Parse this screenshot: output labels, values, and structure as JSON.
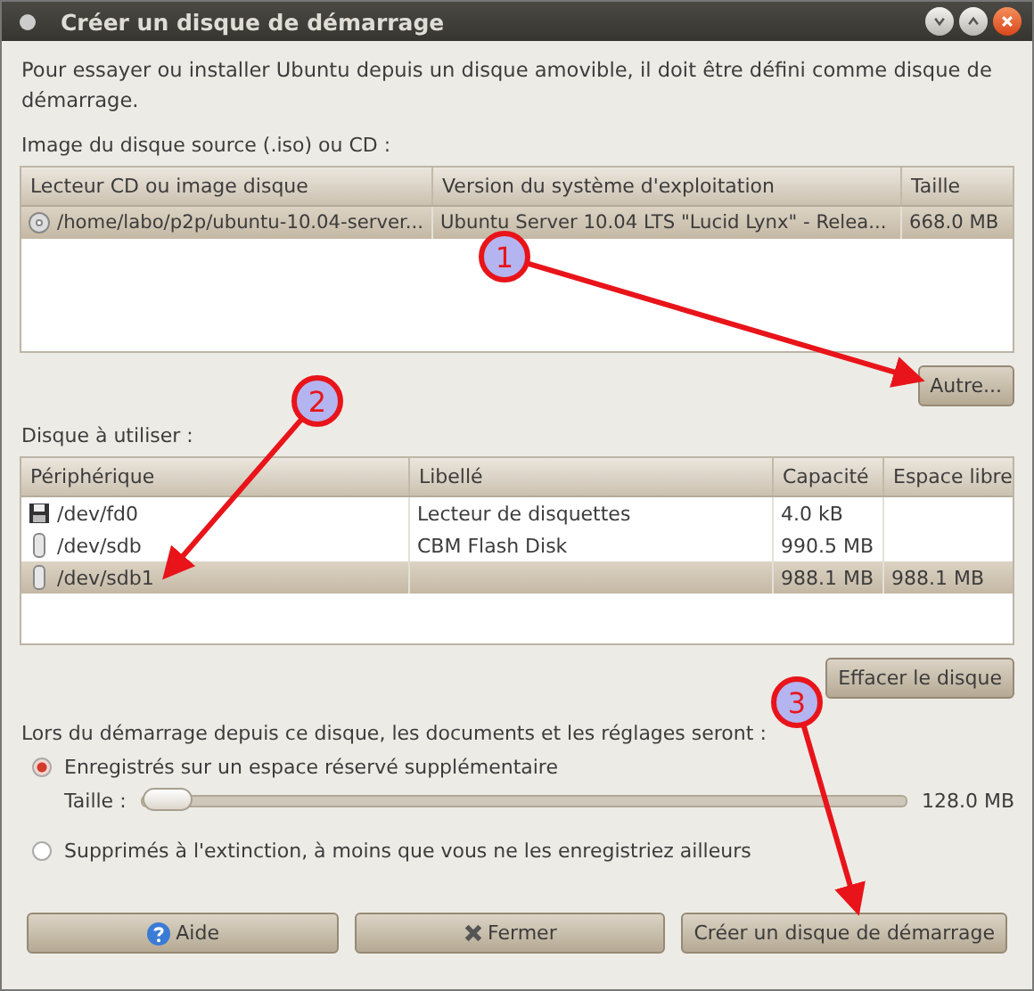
{
  "window": {
    "title": "Créer un disque de démarrage"
  },
  "description": "Pour essayer ou installer Ubuntu depuis un disque amovible, il doit être défini comme disque de démarrage.",
  "source": {
    "label": "Image du disque source (.iso) ou CD :",
    "columns": [
      "Lecteur CD ou image disque",
      "Version du système d'exploitation",
      "Taille"
    ],
    "rows": [
      {
        "kind": "cd",
        "selected": true,
        "cells": [
          "/home/labo/p2p/ubuntu-10.04-server...",
          "Ubuntu Server 10.04 LTS \"Lucid Lynx\" - Relea...",
          "668.0 MB"
        ]
      }
    ],
    "button": "Autre..."
  },
  "target": {
    "label": "Disque à utiliser :",
    "columns": [
      "Périphérique",
      "Libellé",
      "Capacité",
      "Espace libre"
    ],
    "rows": [
      {
        "kind": "floppy",
        "selected": false,
        "cells": [
          "/dev/fd0",
          "Lecteur de disquettes",
          "4.0 kB",
          ""
        ]
      },
      {
        "kind": "usb",
        "selected": false,
        "cells": [
          "/dev/sdb",
          "CBM Flash Disk",
          "990.5 MB",
          ""
        ]
      },
      {
        "kind": "usb",
        "selected": true,
        "cells": [
          "/dev/sdb1",
          "",
          "988.1 MB",
          "988.1 MB"
        ]
      }
    ],
    "button": "Effacer le disque"
  },
  "persistence": {
    "label": "Lors du démarrage depuis ce disque, les documents et les réglages seront :",
    "options": [
      {
        "kind": "radio",
        "label": "Enregistrés sur un espace réservé supplémentaire",
        "selected": true
      },
      {
        "kind": "slider",
        "label": "Taille :",
        "level": 0,
        "reading": "128.0 MB"
      },
      {
        "kind": "radio",
        "label": "Supprimés à l'extinction, à moins que vous ne les enregistriez ailleurs",
        "selected": false
      }
    ]
  },
  "buttons": [
    {
      "kind": "help",
      "label": "Aide"
    },
    {
      "kind": "close",
      "label": "Fermer"
    },
    {
      "kind": "plain",
      "label": "Créer un disque de démarrage"
    }
  ],
  "callouts": [
    {
      "number": "1"
    },
    {
      "number": "2"
    },
    {
      "number": "3"
    }
  ]
}
